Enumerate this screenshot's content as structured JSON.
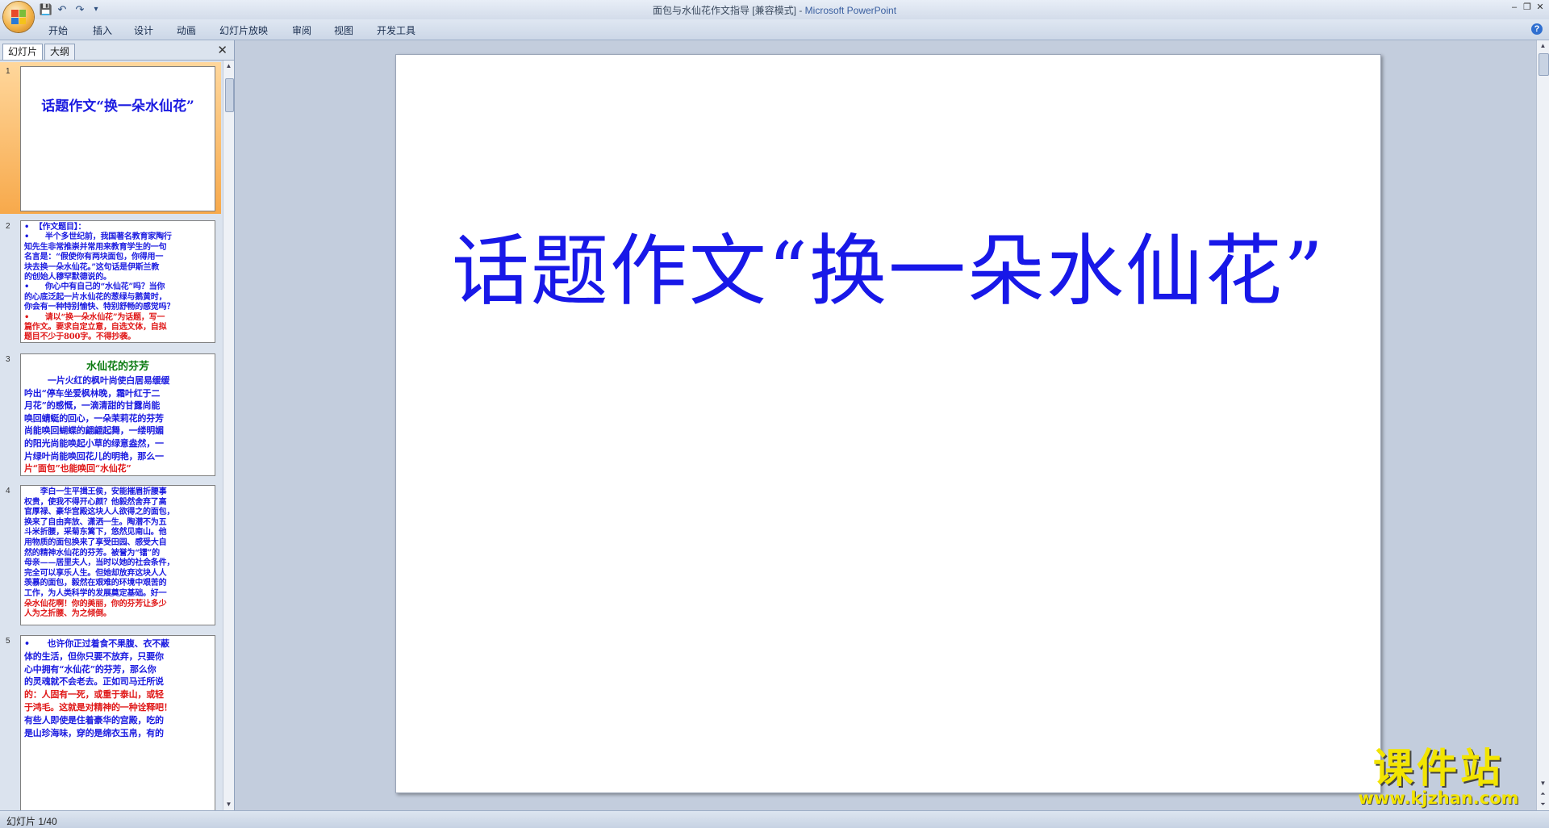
{
  "window": {
    "title": "面包与水仙花作文指导 [兼容模式]",
    "title_sep": " - ",
    "app_name": "Microsoft PowerPoint",
    "minimize": "‒",
    "maximize": "❐",
    "close": "✕"
  },
  "qat": {
    "save_icon": "💾",
    "undo_icon": "↶",
    "redo_icon": "↷",
    "more_icon": "▾"
  },
  "ribbon": {
    "tabs": [
      "开始",
      "插入",
      "设计",
      "动画",
      "幻灯片放映",
      "审阅",
      "视图",
      "开发工具"
    ],
    "help": "?"
  },
  "pane": {
    "tabs": [
      "幻灯片",
      "大纲"
    ],
    "close": "✕",
    "slides": [
      {
        "num": "1",
        "title": "话题作文“换一朵水仙花”"
      },
      {
        "num": "2",
        "lines": [
          {
            "c": "blue",
            "t": "•  【作文题目】："
          },
          {
            "c": "blue",
            "t": "•      半个多世纪前，我国著名教育家陶行"
          },
          {
            "c": "blue",
            "t": "知先生非常推崇并常用来教育学生的一句"
          },
          {
            "c": "blue",
            "t": "名言是：“假使你有两块面包，你得用一"
          },
          {
            "c": "blue",
            "t": "块去换一朵水仙花。”这句话是伊斯兰教"
          },
          {
            "c": "blue",
            "t": "的创始人穆罕默德说的。"
          },
          {
            "c": "blue",
            "t": "•      你心中有自己的“水仙花”吗？当你"
          },
          {
            "c": "blue",
            "t": "的心底泛起一片水仙花的葱绿与鹅黄时，"
          },
          {
            "c": "blue",
            "t": "你会有一种特别愉快、特别舒畅的感觉吗？"
          },
          {
            "c": "red",
            "t": "•      请以“换一朵水仙花”为话题，写一"
          },
          {
            "c": "red",
            "t": "篇作文。要求自定立意，自选文体，自拟"
          },
          {
            "c": "red",
            "t": "题目不少于800字。不得抄袭。"
          }
        ]
      },
      {
        "num": "3",
        "heading": "水仙花的芬芳",
        "lines": [
          {
            "c": "blue",
            "t": "        一片火红的枫叶尚使白居易缓缓"
          },
          {
            "c": "blue",
            "t": "吟出“停车坐爱枫林晚，霜叶红于二"
          },
          {
            "c": "blue",
            "t": "月花”的感慨，一滴清甜的甘露尚能"
          },
          {
            "c": "blue",
            "t": "唤回蜻蜓的回心，一朵茉莉花的芬芳"
          },
          {
            "c": "blue",
            "t": "尚能唤回蝴蝶的翩翩起舞，一缕明媚"
          },
          {
            "c": "blue",
            "t": "的阳光尚能唤起小草的绿意盎然，一"
          },
          {
            "c": "blue",
            "t": "片绿叶尚能唤回花儿的明艳，那么一"
          },
          {
            "c": "red",
            "t": "片“面包”也能唤回“水仙花”"
          },
          {
            "c": "red",
            "t": "的芬芳。"
          }
        ]
      },
      {
        "num": "4",
        "lines": [
          {
            "c": "blue",
            "t": "      李白一生平揖王侯，安能摧眉折腰事"
          },
          {
            "c": "blue",
            "t": "权贵，使我不得开心颜？他毅然舍弃了高"
          },
          {
            "c": "blue",
            "t": "官厚禄、豪华宫殿这块人人欲得之的面包，"
          },
          {
            "c": "blue",
            "t": "换来了自由奔放、潇洒一生。陶潜不为五"
          },
          {
            "c": "blue",
            "t": "斗米折腰，采菊东篱下，悠然见南山。他"
          },
          {
            "c": "blue",
            "t": "用物质的面包换来了享受田园、感受大自"
          },
          {
            "c": "blue",
            "t": "然的精神水仙花的芬芳。被誉为“镭”的"
          },
          {
            "c": "blue",
            "t": "母亲——居里夫人，当时以她的社会条件，"
          },
          {
            "c": "blue",
            "t": "完全可以享乐人生。但她却放弃这块人人"
          },
          {
            "c": "blue",
            "t": "羡慕的面包，毅然在艰难的环境中艰苦的"
          },
          {
            "c": "blue",
            "t": "工作，为人类科学的发展奠定基础。好一"
          },
          {
            "c": "red",
            "t": "朵水仙花啊！你的美丽，你的芬芳让多少"
          },
          {
            "c": "red",
            "t": "人为之折腰、为之倾倒。"
          }
        ]
      },
      {
        "num": "5",
        "lines": [
          {
            "c": "blue",
            "t": "•      也许你正过着食不果腹、衣不蔽"
          },
          {
            "c": "blue",
            "t": "体的生活，但你只要不放弃，只要你"
          },
          {
            "c": "blue",
            "t": "心中拥有“水仙花”的芬芳，那么你"
          },
          {
            "c": "blue",
            "t": "的灵魂就不会老去。正如司马迁所说"
          },
          {
            "c": "red",
            "t": "的：人固有一死，或重于泰山，或轻"
          },
          {
            "c": "red",
            "t": "于鸿毛。这就是对精神的一种诠释吧！"
          },
          {
            "c": "blue",
            "t": "有些人即使是住着豪华的宫殿，吃的"
          },
          {
            "c": "blue",
            "t": "是山珍海味，穿的是绵衣玉帛，有的"
          }
        ]
      }
    ]
  },
  "main": {
    "slide_title": "话题作文“换一朵水仙花”"
  },
  "watermark": {
    "text": "课件站",
    "url": "www.kjzhan.com"
  },
  "status": {
    "text": "幻灯片 1/40"
  },
  "colors": {
    "title_blue": "#1818e8",
    "text_red": "#e01818",
    "selected": "#f7a94b"
  }
}
